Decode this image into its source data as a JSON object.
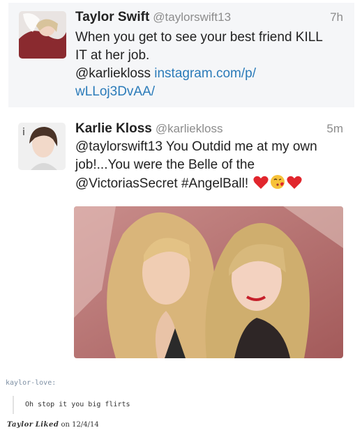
{
  "tweets": [
    {
      "name": "Taylor Swift",
      "handle": "@taylorswift13",
      "time": "7h",
      "text_line1": "When you get to see your best friend KILL",
      "text_line2": "IT at her job.",
      "mention": "@karliekloss",
      "link_part1": "instagram.com/p/",
      "link_part2": "wLLoj3DvAA/"
    },
    {
      "name": "Karlie Kloss",
      "handle": "@karliekloss",
      "time": "5m",
      "text_line1": "@taylorswift13 You Outdid me at my own",
      "text_line2": "job!...You were the Belle of the",
      "text_line3": "@VictoriasSecret #AngelBall!",
      "emojis": [
        "heart-emoji",
        "kiss-face-emoji",
        "heart-emoji"
      ]
    }
  ],
  "reblog": {
    "source": "kaylor-love:",
    "quote": "Oh stop it you big flirts",
    "author": "Taylor",
    "action": "Liked",
    "date_text": "on 12/4/14"
  },
  "colors": {
    "link": "#2b7bb9",
    "muted": "#8c8c8c",
    "card_bg": "#f5f6f8",
    "reblog_source": "#7d8fa3"
  }
}
